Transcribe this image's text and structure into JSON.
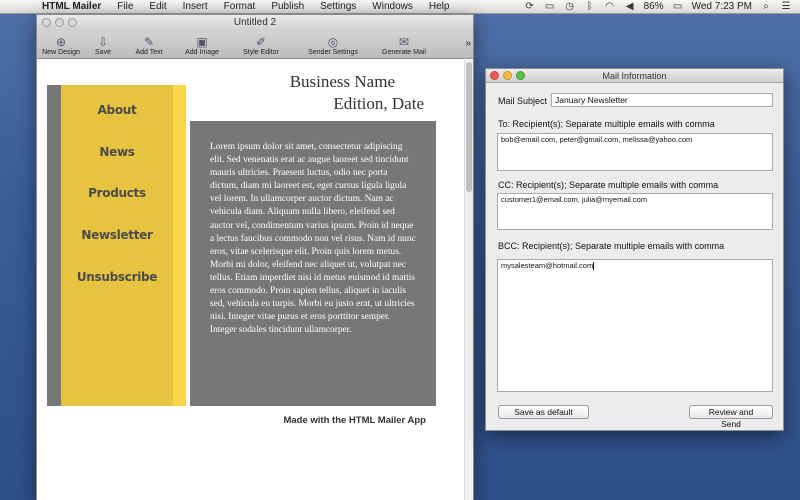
{
  "menubar": {
    "app_name": "HTML Mailer",
    "items": [
      "File",
      "Edit",
      "Insert",
      "Format",
      "Publish",
      "Settings",
      "Windows",
      "Help"
    ],
    "battery": "86%",
    "clock": "Wed 7:23 PM"
  },
  "editor": {
    "window_title": "Untitled 2",
    "toolbar": {
      "new_design": "New Design",
      "save": "Save",
      "add_text": "Add Text",
      "add_image": "Add Image",
      "style_editor": "Style Editor",
      "sender_settings": "Sender Settings",
      "generate_mail": "Generate Mail"
    }
  },
  "newsletter": {
    "business_name": "Business Name",
    "edition_date": "Edition, Date",
    "nav": [
      "About",
      "News",
      "Products",
      "Newsletter",
      "Unsubscribe"
    ],
    "body": "Lorem ipsum dolor sit amet, consectetur adipiscing elit. Sed venenatis erat ac augue laoreet sed tincidunt mauris ultricies. Praesent luctus, odio nec porta dictum, diam mi laoreet est, eget cursus ligula ligula vel lorem. In ullamcorper auctor dictum. Nam ac vehicula diam. Aliquam nulla libero, eleifend sed auctor vel, condimentum varius ipsum. Proin id neque a lectus faucibus commodo non vel risus. Nam id nunc eros, vitae scelerisque elit. Proin quis lorem metus. Morbi mi dolor, eleifend nec aliquet ut, volutpat nec tellus. Etiam imperdiet nisi id metus euismod id mattis eros commodo. Proin sapien tellus, aliquet in iaculis sed, vehicula eu turpis. Morbi eu justo erat, ut ultricies nisi. Integer vitae purus et eros porttitor semper. Integer sodales tincidunt ullamcorper.",
    "made_with": "Made with the HTML Mailer App"
  },
  "mail_info": {
    "window_title": "Mail Information",
    "subject_label": "Mail Subject",
    "subject_value": "January Newsletter",
    "to_label": "To: Recipient(s); Separate multiple emails with comma",
    "to_value": "bob@email.com, peter@gmail.com, melissa@yahoo.com",
    "cc_label": "CC: Recipient(s); Separate multiple emails with comma",
    "cc_value": "customer1@email.com, julia@myemail.com",
    "bcc_label": "BCC: Recipient(s); Separate multiple emails with comma",
    "bcc_value": "mysalesteam@hotmail.com",
    "save_default": "Save as default",
    "review_send": "Review and Send"
  }
}
